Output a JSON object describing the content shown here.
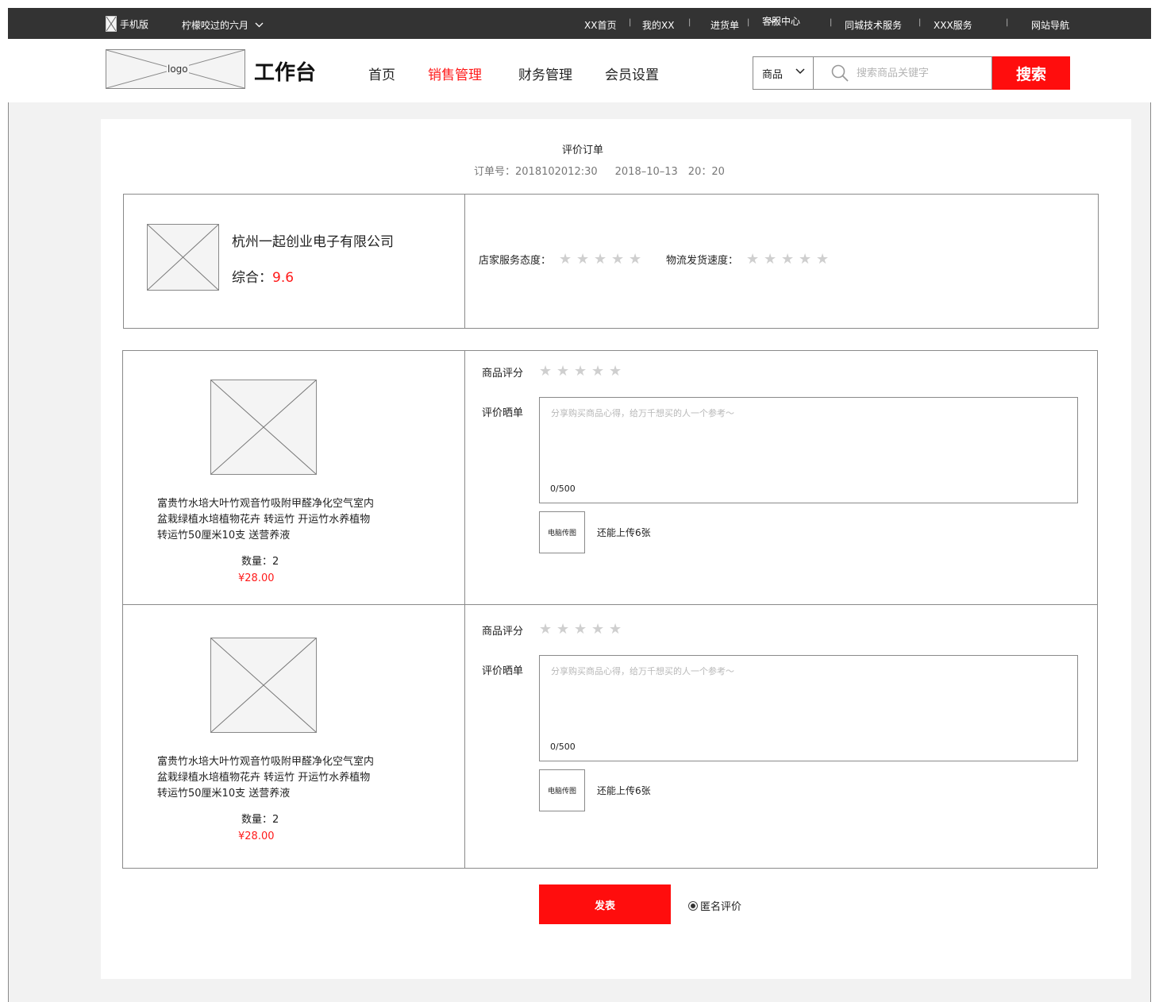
{
  "topbar": {
    "mobile": "手机版",
    "user": "柠檬咬过的六月",
    "links": {
      "home": "XX首页",
      "my": "我的XX",
      "purchase": "进货单",
      "service_center": "客服中心",
      "local_tech": "同城技术服务",
      "xxx_service": "XXX服务",
      "site_nav": "网站导航"
    },
    "separator": "|"
  },
  "header": {
    "logo": "logo",
    "title": "工作台",
    "nav": [
      "首页",
      "销售管理",
      "财务管理",
      "会员设置"
    ],
    "active_nav": "销售管理",
    "search": {
      "category": "商品",
      "placeholder": "搜索商品关键字",
      "button": "搜索"
    }
  },
  "review": {
    "title": "评价订单",
    "order_no": "订单号：2018102012:30",
    "order_time": "2018–10–13　20：20",
    "shop": {
      "name": "杭州一起创业电子有限公司",
      "score_label": "综合：",
      "score": "9.6",
      "service_label": "店家服务态度：",
      "logistics_label": "物流发货速度："
    },
    "items": [
      {
        "desc": "富贵竹水培大叶竹观音竹吸附甲醛净化空气室内盆栽绿植水培植物花卉 转运竹 开运竹水养植物 转运竹50厘米10支 送营养液",
        "qty": "数量：2",
        "price": "¥28.00",
        "rating_label": "商品评分",
        "review_label": "评价晒单",
        "placeholder": "分享购买商品心得，给万千想买的人一个参考～",
        "count": "0/500",
        "upload": "电脑传图",
        "remain": "还能上传6张"
      },
      {
        "desc": "富贵竹水培大叶竹观音竹吸附甲醛净化空气室内盆栽绿植水培植物花卉 转运竹 开运竹水养植物 转运竹50厘米10支 送营养液",
        "qty": "数量：2",
        "price": "¥28.00",
        "rating_label": "商品评分",
        "review_label": "评价晒单",
        "placeholder": "分享购买商品心得，给万千想买的人一个参考～",
        "count": "0/500",
        "upload": "电脑传图",
        "remain": "还能上传6张"
      }
    ],
    "submit": "发表",
    "anonymous": "匿名评价"
  },
  "icons": {
    "star": "star-icon",
    "search": "search-icon",
    "chevron": "chevron-down-icon",
    "phone": "phone-icon"
  },
  "colors": {
    "accent": "#ff0d0d",
    "topbar": "#333333",
    "star_empty": "#cfcfcf"
  }
}
